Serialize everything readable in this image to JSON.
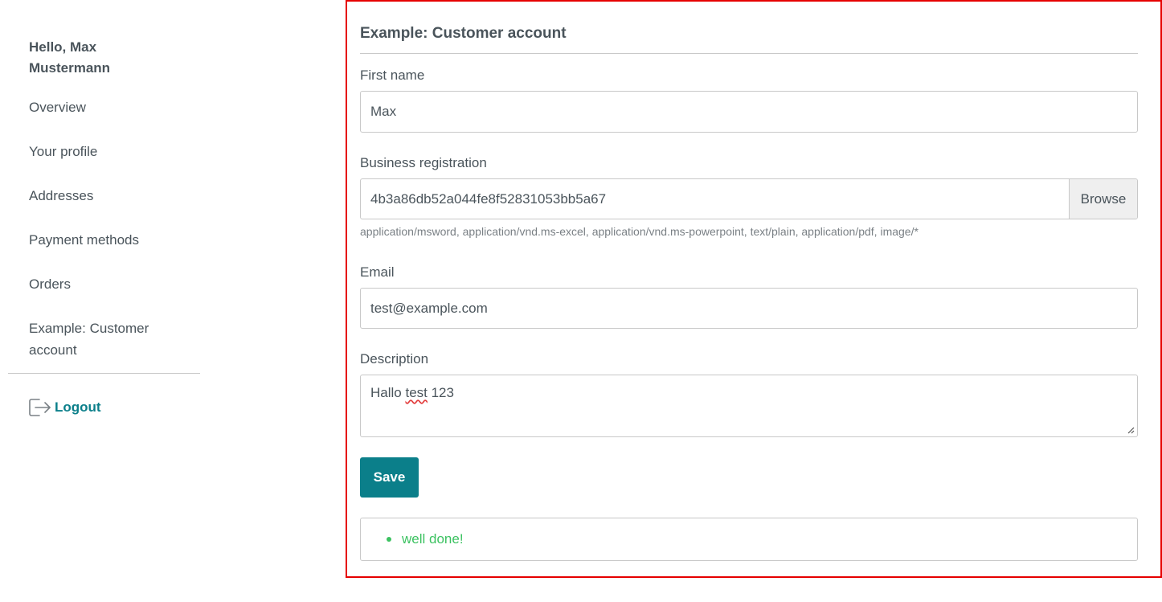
{
  "sidebar": {
    "greeting_line1": "Hello, Max",
    "greeting_line2": "Mustermann",
    "items": [
      {
        "label": "Overview"
      },
      {
        "label": "Your profile"
      },
      {
        "label": "Addresses"
      },
      {
        "label": "Payment methods"
      },
      {
        "label": "Orders"
      },
      {
        "label": "Example: Customer",
        "label2": "account"
      }
    ],
    "logout_label": "Logout",
    "logout_icon": "logout-icon"
  },
  "main": {
    "title": "Example: Customer account",
    "first_name": {
      "label": "First name",
      "value": "Max"
    },
    "business_registration": {
      "label": "Business registration",
      "file_name": "4b3a86db52a044fe8f52831053bb5a67",
      "browse_label": "Browse",
      "hint": "application/msword, application/vnd.ms-excel, application/vnd.ms-powerpoint, text/plain, application/pdf, image/*"
    },
    "email": {
      "label": "Email",
      "value": "test@example.com"
    },
    "description": {
      "label": "Description",
      "value_prefix": "Hallo ",
      "value_misspelled": "test",
      "value_suffix": " 123"
    },
    "save_label": "Save",
    "alert_message": "well done!"
  },
  "colors": {
    "accent": "#0b7f8a",
    "success": "#3cc261",
    "highlight_frame": "#e60000",
    "text": "#4a545b"
  }
}
